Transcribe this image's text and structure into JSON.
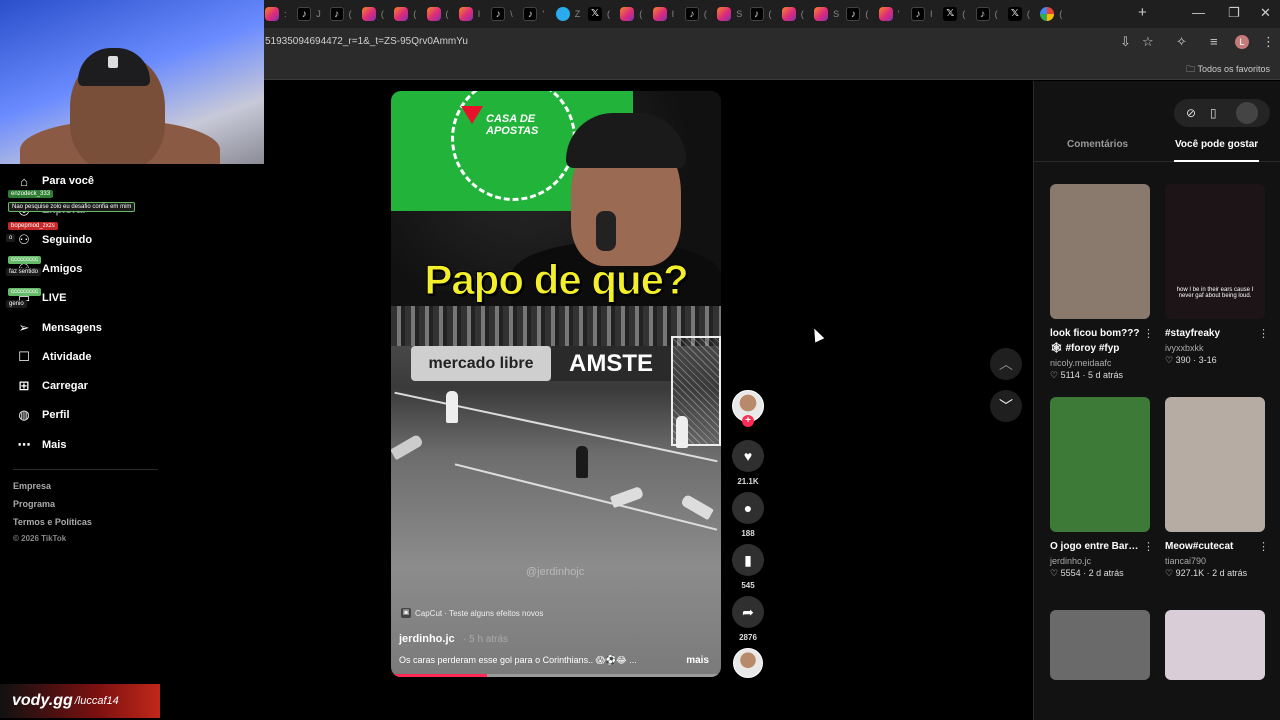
{
  "browser": {
    "url": "51935094694472_r=1&_t=ZS-95Qrv0AmmYu",
    "bookmarks_label": "Todos os favoritos",
    "profile_initial": "L",
    "tab_seps": [
      ":",
      "J",
      "(",
      "(",
      "(",
      "(",
      "I",
      "\\",
      "'",
      "Z",
      "(",
      "(",
      "I",
      "(",
      "S",
      "(",
      "(",
      "S",
      "(",
      "'",
      "I",
      "(",
      "(",
      "(",
      "(",
      "'",
      "(",
      "(",
      "(",
      "x"
    ]
  },
  "nav": {
    "items": [
      {
        "label": "Para você",
        "icon": "home-icon"
      },
      {
        "label": "Explorar",
        "icon": "compass-icon"
      },
      {
        "label": "Seguindo",
        "icon": "following-icon"
      },
      {
        "label": "Amigos",
        "icon": "friends-icon"
      },
      {
        "label": "LIVE",
        "icon": "live-icon"
      },
      {
        "label": "Mensagens",
        "icon": "send-icon"
      },
      {
        "label": "Atividade",
        "icon": "inbox-icon"
      },
      {
        "label": "Carregar",
        "icon": "upload-icon"
      },
      {
        "label": "Perfil",
        "icon": "profile-icon"
      },
      {
        "label": "Mais",
        "icon": "more-icon"
      }
    ],
    "footer": [
      "Empresa",
      "Programa",
      "Termos e Políticas"
    ],
    "copyright": "© 2026 TikTok"
  },
  "chat_overlay": [
    {
      "text": "enzodeck_333",
      "color": "#2e7d32"
    },
    {
      "text": "Nao pesquise zolo eu desafio confia em mim",
      "color": "#1b1b1b"
    },
    {
      "text": "bopepmod_zxzs",
      "color": "#c62828"
    },
    {
      "text": "o",
      "color": "#1b1b1b"
    },
    {
      "text": "ccccccccc",
      "color": "#66bb6a"
    },
    {
      "text": "faz sentido",
      "color": "#1b1b1b"
    },
    {
      "text": "ccccccccc",
      "color": "#66bb6a"
    },
    {
      "text": "genio",
      "color": "#1b1b1b"
    }
  ],
  "watermark": {
    "logo": "vody.gg",
    "user": "/luccaf14"
  },
  "video": {
    "overlay_title": "Papo de que?",
    "sponsor": "CASA DE APOSTAS",
    "boards": [
      "mercado libre",
      "AMSTE"
    ],
    "handle_watermark": "@jerdinhojc",
    "capcut": "CapCut · Teste alguns efeitos novos",
    "author": "jerdinho.jc",
    "time": "· 5 h atrás",
    "description": "Os caras perderam esse gol para o Corinthians.. 😱⚽😂 ...",
    "more": "mais",
    "progress": 0.29
  },
  "actions": {
    "likes": "21.1K",
    "comments": "188",
    "saves": "545",
    "shares": "2876"
  },
  "panel": {
    "tabs": [
      "Comentários",
      "Você pode gostar"
    ],
    "active_tab": "Você pode gostar",
    "cards": [
      {
        "title": "look ficou bom??? 🕸 #foroy #fyp",
        "author": "nicoly.meidaafc",
        "likes": "5114",
        "date": "5 d atrás",
        "bg": "#8a7a6e"
      },
      {
        "title": "#stayfreaky",
        "author": "ivyxxbxkk",
        "likes": "390",
        "date": "3-16",
        "bg": "#1c1416",
        "caption": "how I be in their ears cause I never gaf about being loud."
      },
      {
        "title": "O jogo entre Barracas central ...",
        "author": "jerdinho.jc",
        "likes": "5554",
        "date": "2 d atrás",
        "bg": "#3e7a37"
      },
      {
        "title": "Meow#cutecat",
        "author": "tiancai790",
        "likes": "927.1K",
        "date": "2 d atrás",
        "bg": "#b7aca4"
      },
      {
        "title": "",
        "author": "",
        "likes": "",
        "date": "",
        "bg": "#6a6a6a"
      },
      {
        "title": "",
        "author": "",
        "likes": "",
        "date": "",
        "bg": "#d9cdd8"
      }
    ]
  }
}
